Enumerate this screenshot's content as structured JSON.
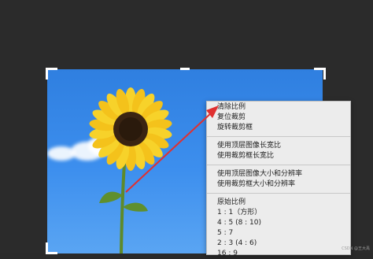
{
  "context_menu": {
    "groups": [
      {
        "items": [
          {
            "label": "清除比例"
          },
          {
            "label": "复位裁剪"
          },
          {
            "label": "旋转裁剪框"
          }
        ]
      },
      {
        "items": [
          {
            "label": "使用顶层图像长宽比"
          },
          {
            "label": "使用裁剪框长宽比"
          }
        ]
      },
      {
        "items": [
          {
            "label": "使用顶层图像大小和分辨率"
          },
          {
            "label": "使用裁剪框大小和分辨率"
          }
        ]
      },
      {
        "items": [
          {
            "label": "原始比例"
          },
          {
            "label": "1 : 1（方形）"
          },
          {
            "label": "4 : 5 (8 : 10)"
          },
          {
            "label": "5 : 7"
          },
          {
            "label": "2 : 3 (4 : 6)"
          },
          {
            "label": "16 : 9"
          }
        ]
      }
    ]
  },
  "watermark": "CSDN @王大禹",
  "colors": {
    "annotation_arrow": "#e03030",
    "sky": "#3a8de9",
    "menu_bg": "#ececec",
    "canvas": "#2b2b2b"
  },
  "icons": {
    "annotation": "red-arrow-icon",
    "subject": "sunflower-image"
  }
}
